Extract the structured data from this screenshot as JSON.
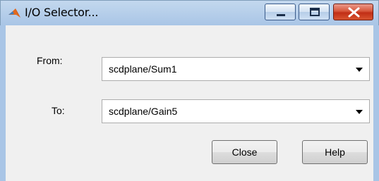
{
  "window": {
    "title": "I/O Selector...",
    "app_icon": "matlab-icon",
    "controls": [
      "minimize-icon",
      "maximize-icon",
      "close-icon"
    ],
    "close_color": "#c42b1c"
  },
  "form": {
    "from_label": "From:",
    "from_value": "scdplane/Sum1",
    "to_label": "To:",
    "to_value": "scdplane/Gain5"
  },
  "buttons": {
    "close_label": "Close",
    "help_label": "Help"
  }
}
